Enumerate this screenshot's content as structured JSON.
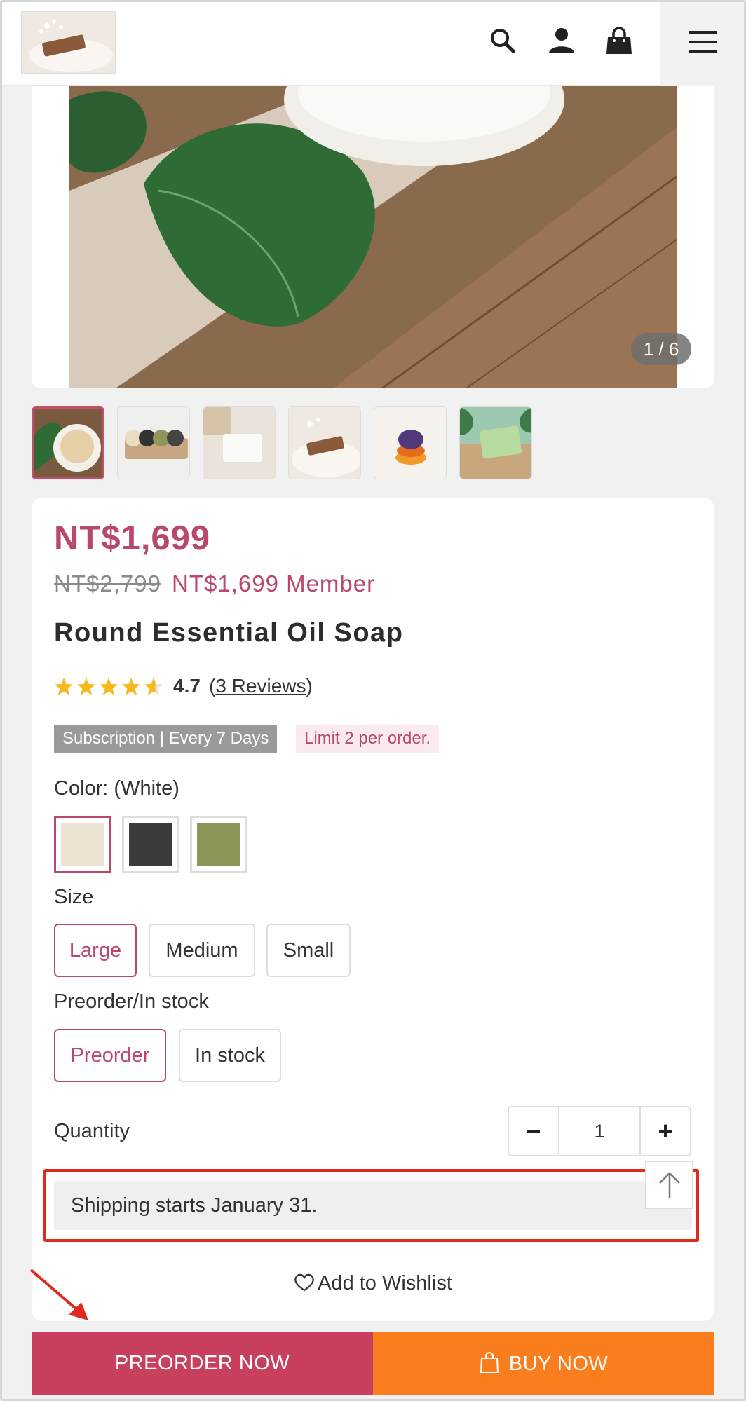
{
  "header": {
    "icons": [
      "search-icon",
      "user-icon",
      "cart-icon",
      "menu-icon"
    ]
  },
  "gallery": {
    "counter": "1 / 6",
    "thumbnail_count": 6
  },
  "product": {
    "price": "NT$1,699",
    "original_price": "NT$2,799",
    "member_price": "NT$1,699 Member",
    "title": "Round Essential Oil Soap",
    "rating": {
      "stars": 4.7,
      "value": "4.7",
      "reviews_link": "3 Reviews",
      "open_paren": "(",
      "close_paren": ")"
    },
    "tags": {
      "subscription": "Subscription | Every 7 Days",
      "limit": "Limit 2 per order."
    },
    "color": {
      "label": "Color: (White)",
      "swatches": [
        {
          "name": "White",
          "hex": "#ede4d6",
          "selected": true
        },
        {
          "name": "Black",
          "hex": "#3b3b3b",
          "selected": false
        },
        {
          "name": "Olive",
          "hex": "#8f965a",
          "selected": false
        }
      ]
    },
    "size": {
      "label": "Size",
      "options": [
        "Large",
        "Medium",
        "Small"
      ],
      "selected": "Large"
    },
    "availability": {
      "label": "Preorder/In stock",
      "options": [
        "Preorder",
        "In stock"
      ],
      "selected": "Preorder"
    },
    "quantity": {
      "label": "Quantity",
      "value": "1",
      "minus": "−",
      "plus": "+"
    },
    "shipping_note": "Shipping starts January 31.",
    "wishlist_label": "Add to Wishlist"
  },
  "cta": {
    "preorder_label": "PREORDER NOW",
    "buy_label": "BUY NOW"
  },
  "colors": {
    "accent": "#b9486a",
    "preorder_bg": "#c9405f",
    "buy_bg": "#fa7e1e",
    "highlight": "#e02a1e"
  }
}
